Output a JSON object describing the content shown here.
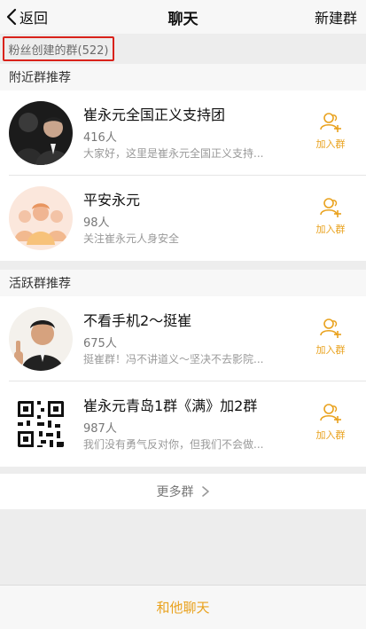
{
  "nav": {
    "back_label": "返回",
    "title": "聊天",
    "right_label": "新建群"
  },
  "fan_groups": {
    "label": "粉丝创建的群(522)"
  },
  "sections": {
    "nearby": {
      "title": "附近群推荐",
      "groups": [
        {
          "name": "崔永元全国正义支持团",
          "count": "416人",
          "desc": "大家好，这里是崔永元全国正义支持..."
        },
        {
          "name": "平安永元",
          "count": "98人",
          "desc": "关注崔永元人身安全"
        }
      ]
    },
    "active": {
      "title": "活跃群推荐",
      "groups": [
        {
          "name": "不看手机2～挺崔",
          "count": "675人",
          "desc": "挺崔群！冯不讲道义～坚决不去影院..."
        },
        {
          "name": "崔永元青岛1群《满》加2群",
          "count": "987人",
          "desc": "我们没有勇气反对你，但我们不会做..."
        }
      ]
    }
  },
  "join_label": "加入群",
  "more_label": "更多群",
  "bottom_label": "和他聊天",
  "colors": {
    "accent": "#e9a21e",
    "highlight_border": "#d9221b"
  },
  "icons": {
    "back": "chevron-left-icon",
    "join": "add-group-icon",
    "more": "chevron-right-icon"
  }
}
